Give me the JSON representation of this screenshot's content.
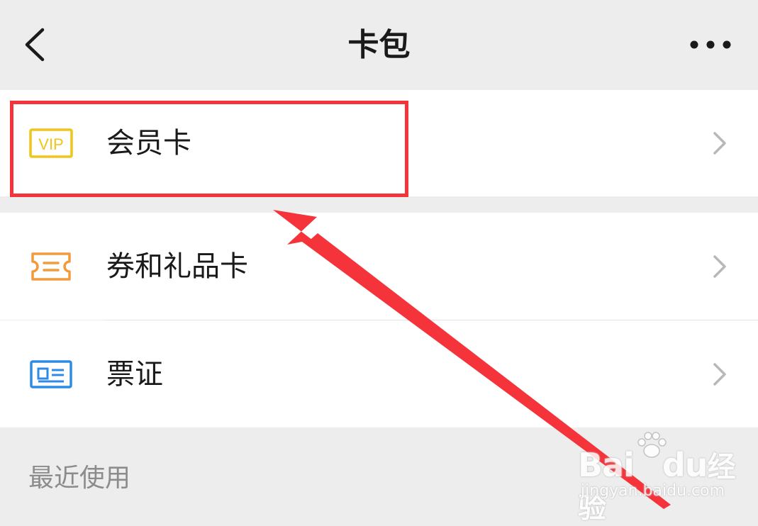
{
  "header": {
    "title": "卡包",
    "back_icon": "chevron-left-icon",
    "more_icon": "more-horizontal-icon"
  },
  "menu": {
    "items": [
      {
        "label": "会员卡",
        "icon": "vip-card-icon",
        "icon_color": "#f0c419"
      },
      {
        "label": "券和礼品卡",
        "icon": "coupon-ticket-icon",
        "icon_color": "#f39a3b"
      },
      {
        "label": "票证",
        "icon": "id-card-icon",
        "icon_color": "#2f8ae5"
      }
    ],
    "chevron_icon": "chevron-right-icon"
  },
  "recent": {
    "title": "最近使用"
  },
  "annotation": {
    "highlight_color": "#f5333a"
  },
  "watermark": {
    "logo_prefix": "Bai",
    "logo_suffix": "du",
    "logo_cn": "经验",
    "url": "jingyan.baidu.com"
  }
}
